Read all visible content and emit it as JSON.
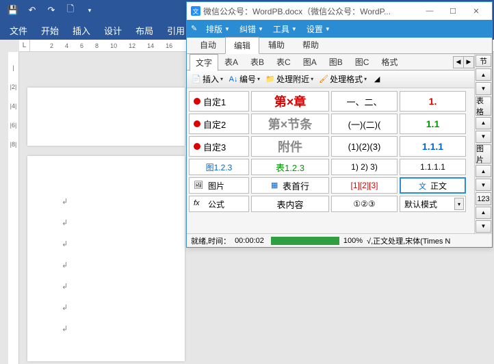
{
  "word": {
    "title_partial": "微信",
    "ribbon": [
      "文件",
      "开始",
      "插入",
      "设计",
      "布局",
      "引用"
    ],
    "ruler_label": "L",
    "ruler_marks": [
      "2",
      "4",
      "6",
      "8",
      "10",
      "12",
      "14",
      "16"
    ],
    "ruler_v": [
      "|",
      "|2|",
      "|4|",
      "|6|",
      "|8|"
    ]
  },
  "plugin": {
    "title": "微信公众号：WordPB.docx（微信公众号：WordP...",
    "menu": [
      "排版",
      "纠错",
      "工具",
      "设置"
    ],
    "tabs1": [
      "自动",
      "编辑",
      "辅助",
      "帮助"
    ],
    "tabs1_active": 1,
    "tabs2": [
      "文字",
      "表A",
      "表B",
      "表C",
      "图A",
      "图B",
      "图C",
      "格式"
    ],
    "tabs2_active": 0,
    "toolbar": {
      "insert": "插入",
      "number": "编号",
      "near": "处理附近",
      "format": "处理格式"
    },
    "rows": [
      {
        "label": "自定1",
        "c1": "第×章",
        "c1_color": "red",
        "c2": "一、二、",
        "c3": "1.",
        "c3_color": "red"
      },
      {
        "label": "自定2",
        "c1": "第×节条",
        "c1_color": "gray",
        "c2": "(一)(二)(",
        "c3": "1.1",
        "c3_color": "green"
      },
      {
        "label": "自定3",
        "c1": "附件",
        "c1_color": "gray",
        "c2": "(1)(2)(3)",
        "c3": "1.1.1",
        "c3_color": "blue"
      }
    ],
    "row4": {
      "label": "图1.2.3",
      "label_color": "blue",
      "c1": "表1.2.3",
      "c1_color": "green",
      "c2": "1) 2) 3)",
      "c3": "1.1.1.1"
    },
    "row5": {
      "label": "图片",
      "c1": "表首行",
      "c2": "[1][2][3]",
      "c2_color": "red",
      "c3": "正文",
      "c3_selected": true
    },
    "row6": {
      "label": "公式",
      "c1": "表内容",
      "c2": "①②③",
      "combo": "默认模式"
    },
    "sidebar": [
      "节",
      "表格",
      "图片",
      "123"
    ],
    "status": {
      "text": "就绪,时间：",
      "time": "00:00:02",
      "pct": "100%",
      "info": "√,正文处理,宋体(Times N",
      "progress": 100
    }
  }
}
